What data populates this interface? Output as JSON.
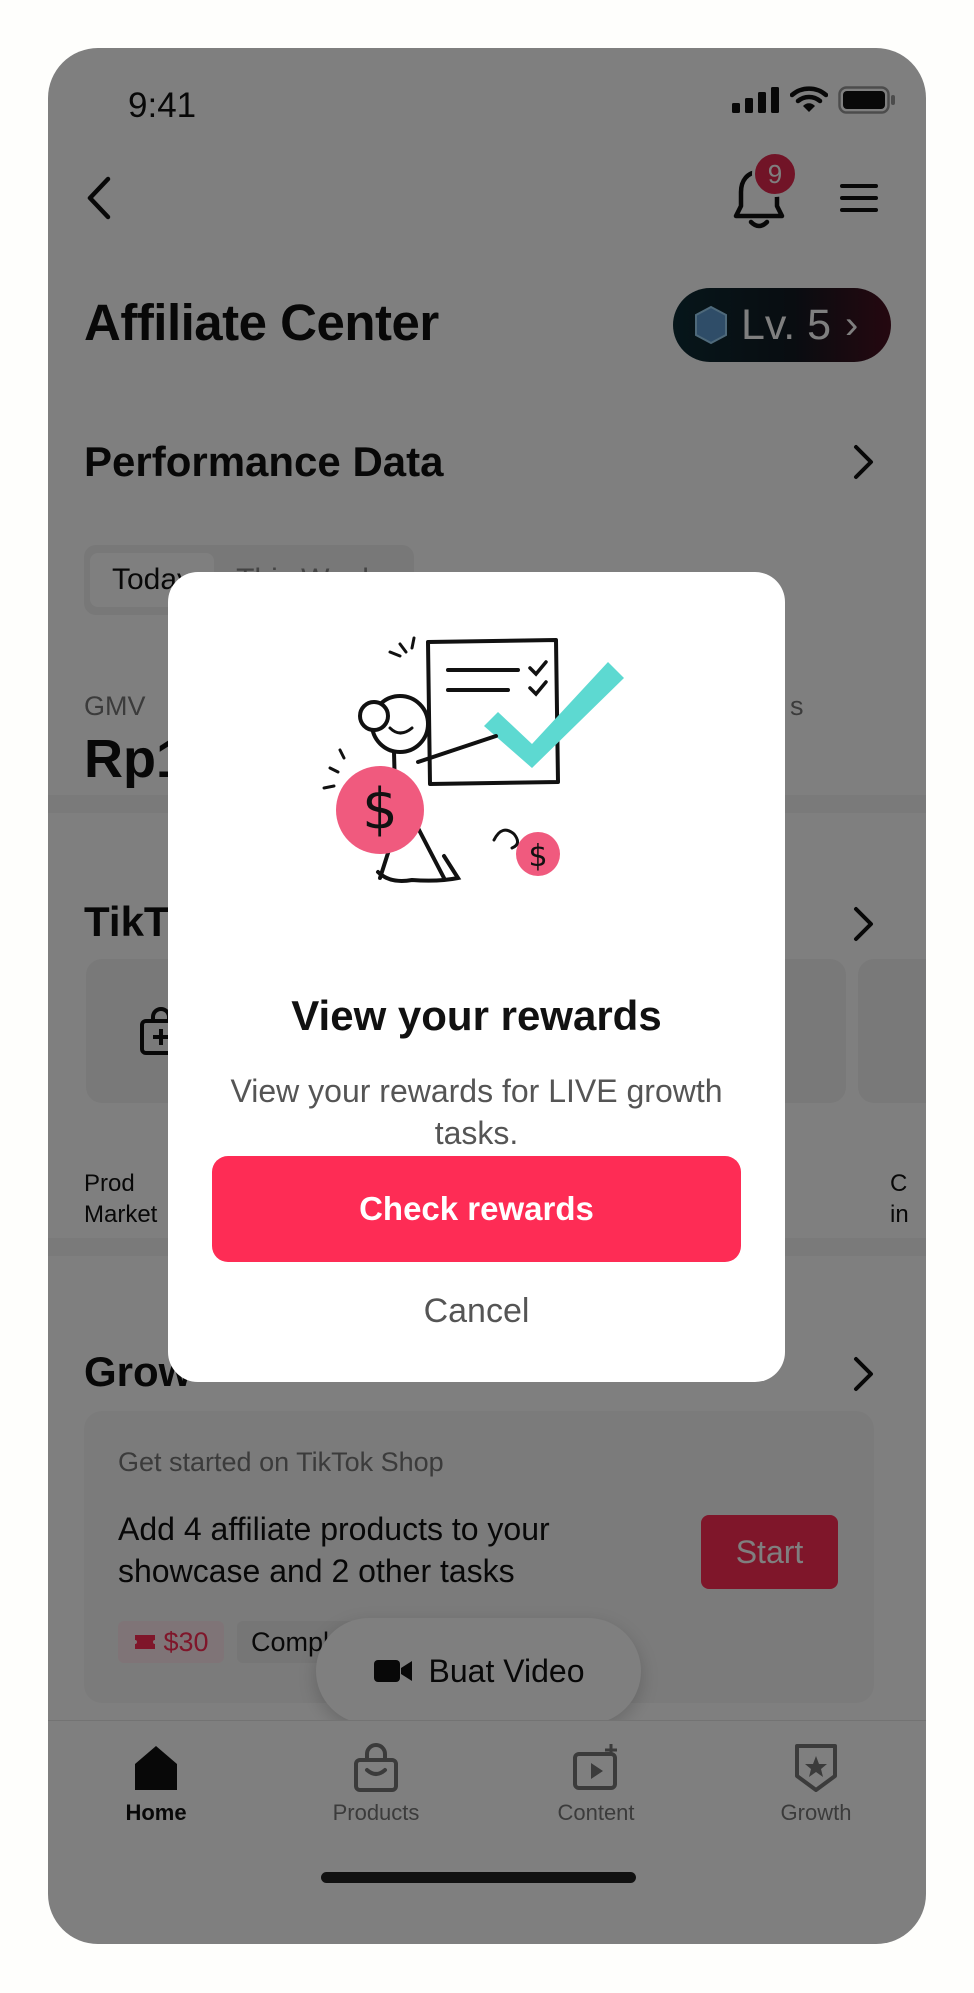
{
  "status": {
    "time": "9:41"
  },
  "header": {
    "notification_count": "9",
    "title": "Affiliate Center",
    "level_label": "Lv. 5"
  },
  "performance": {
    "title": "Performance Data",
    "tabs": [
      "Today",
      "This Week"
    ],
    "gmv_label": "GMV",
    "gmv_value_partial": "Rp1",
    "right_metric_label_partial": "s"
  },
  "tiktok_section": {
    "title_partial": "TikTo",
    "tiles": [
      {
        "label_partial": "Prod\nMarket"
      },
      {
        "label_partial": "C\nin"
      }
    ]
  },
  "growth_section": {
    "title_partial": "Grow",
    "task": {
      "eyebrow": "Get started on TikTok Shop",
      "text": "Add 4 affiliate products to your showcase and 2 other tasks",
      "start_label": "Start",
      "reward": "$30",
      "complete_partial": "Compl"
    }
  },
  "fab": {
    "label": "Buat Video"
  },
  "tabbar": {
    "items": [
      {
        "label": "Home",
        "active": true
      },
      {
        "label": "Products",
        "active": false
      },
      {
        "label": "Content",
        "active": false
      },
      {
        "label": "Growth",
        "active": false
      }
    ]
  },
  "modal": {
    "title": "View your rewards",
    "description": "View your rewards for LIVE growth tasks.",
    "cta_label": "Check rewards",
    "cancel_label": "Cancel"
  },
  "colors": {
    "brand_red": "#fe2c55",
    "teal": "#5dd9d1",
    "pink": "#f05a7e",
    "overlay": "rgba(0,0,0,0.5)"
  },
  "icons": [
    "back-icon",
    "bell-icon",
    "menu-icon",
    "level-hex-icon",
    "chevron-right-icon",
    "home-icon",
    "products-bag-icon",
    "content-video-icon",
    "growth-badge-icon",
    "video-camera-icon",
    "coupon-icon"
  ]
}
